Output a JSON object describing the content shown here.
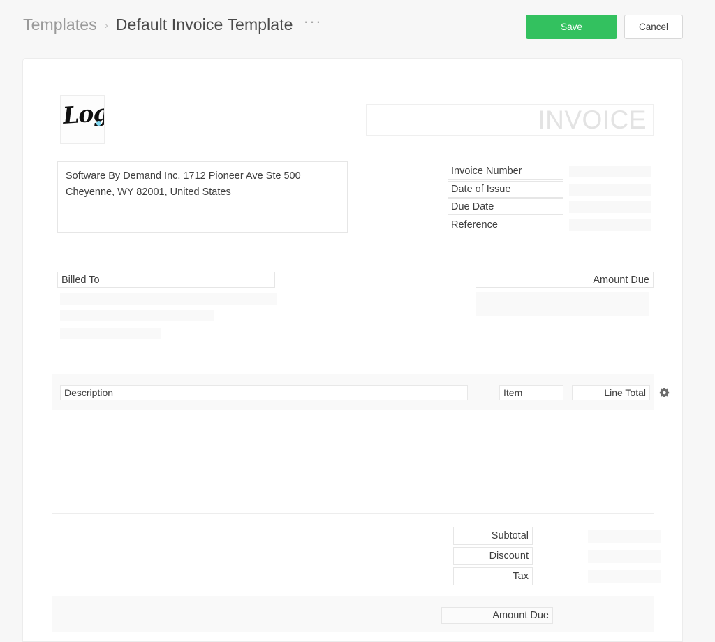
{
  "header": {
    "breadcrumb_root": "Templates",
    "breadcrumb_separator": "›",
    "breadcrumb_current": "Default Invoice Template",
    "more_menu": "···",
    "save_label": "Save",
    "cancel_label": "Cancel",
    "save_color": "#33c15f"
  },
  "invoice": {
    "logo_text": "Logo",
    "logo_dot_color": "#7fd8f2",
    "title": "INVOICE",
    "company_address_line1": "Software By Demand Inc. 1712 Pioneer Ave Ste 500",
    "company_address_line2": "Cheyenne, WY 82001, United States",
    "meta_fields": [
      {
        "label": "Invoice Number",
        "value": ""
      },
      {
        "label": "Date of Issue",
        "value": ""
      },
      {
        "label": "Due Date",
        "value": ""
      },
      {
        "label": "Reference",
        "value": ""
      }
    ],
    "billed_to_label": "Billed To",
    "amount_due_label": "Amount Due",
    "line_items": {
      "description_header": "Description",
      "item_header": "Item",
      "line_total_header": "Line Total",
      "settings_icon": "gear-icon"
    },
    "totals": [
      {
        "label": "Subtotal",
        "value": ""
      },
      {
        "label": "Discount",
        "value": ""
      },
      {
        "label": "Tax",
        "value": ""
      }
    ],
    "grand_total_label": "Amount Due"
  }
}
